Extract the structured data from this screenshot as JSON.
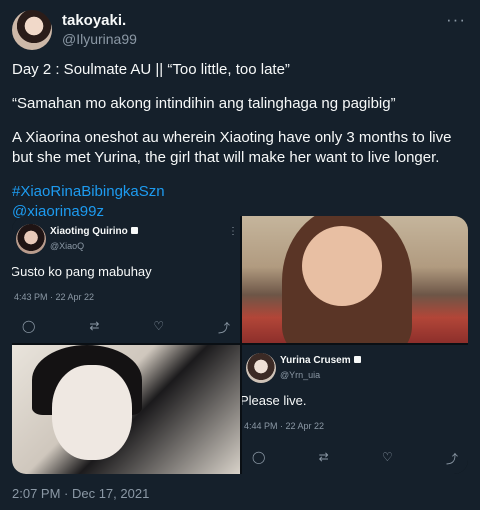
{
  "author": {
    "display_name": "takoyaki.",
    "handle": "@Ilyurina99",
    "avatar_icon": "profile-photo",
    "more_label": "···"
  },
  "tweet": {
    "line1": "Day 2 : Soulmate AU || “Too little, too late”",
    "line2": "“Samahan mo akong intindihin ang talinghaga ng pagibig”",
    "line3": "A Xiaorina oneshot au wherein Xiaoting have only 3 months to live but she met Yurina, the girl that will make her want to live longer.",
    "hashtag": "#XiaoRinaBibingkaSzn",
    "mention": "@xiaorina99z",
    "timestamp": "2:07 PM · Dec 17, 2021"
  },
  "media": {
    "card1": {
      "name": "Xiaoting Quirino",
      "handle": "@XiaoQ",
      "message": "Gusto ko pang mabuhay",
      "time": "4:43 PM · 22 Apr 22",
      "dots": "⋮"
    },
    "card2": {
      "name": "Yurina Crusem",
      "handle": "@Yrn_uia",
      "message": "Please live.",
      "time": "4:44 PM · 22 Apr 22"
    },
    "actions": [
      "reply-icon",
      "retweet-icon",
      "like-icon",
      "share-icon"
    ]
  },
  "colors": {
    "background": "#15202b",
    "text": "#f7f9f9",
    "secondary": "#8b98a5",
    "link": "#1d9bf0"
  }
}
